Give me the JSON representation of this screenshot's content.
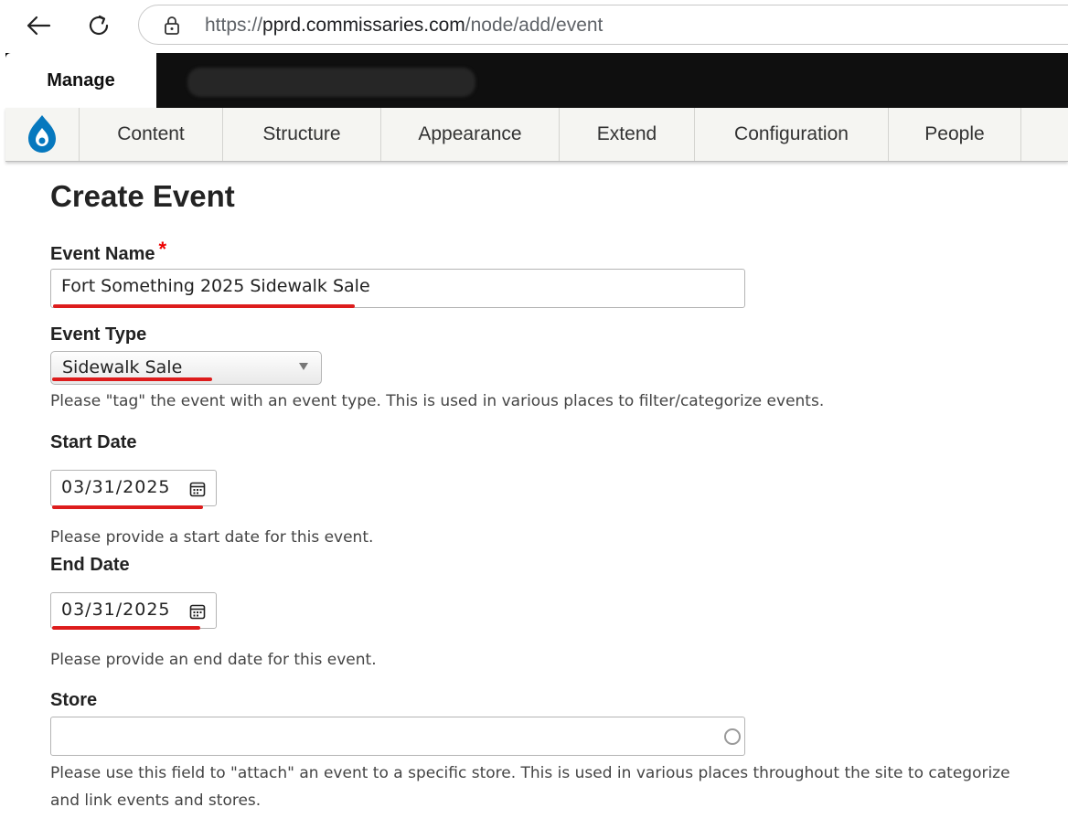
{
  "browser": {
    "url_scheme": "https://",
    "url_domain": "pprd.commissaries.com",
    "url_path": "/node/add/event"
  },
  "toolbar": {
    "manage_label": "Manage"
  },
  "menu": {
    "items": [
      {
        "label": "Content"
      },
      {
        "label": "Structure"
      },
      {
        "label": "Appearance"
      },
      {
        "label": "Extend"
      },
      {
        "label": "Configuration"
      },
      {
        "label": "People"
      }
    ]
  },
  "form": {
    "title": "Create Event",
    "event_name": {
      "label": "Event Name",
      "required_mark": "*",
      "value": "Fort Something 2025 Sidewalk Sale"
    },
    "event_type": {
      "label": "Event Type",
      "value": "Sidewalk Sale",
      "description": "Please \"tag\" the event with an event type. This is used in various places to filter/categorize events."
    },
    "start_date": {
      "label": "Start Date",
      "value": "03/31/2025",
      "description": "Please provide a start date for this event."
    },
    "end_date": {
      "label": "End Date",
      "value": "03/31/2025",
      "description": "Please provide an end date for this event."
    },
    "store": {
      "label": "Store",
      "value": "",
      "description_line1": "Please use this field to \"attach\" an event to a specific store. This is used in various places throughout the site to categorize",
      "description_line2": "and link events and stores."
    }
  },
  "colors": {
    "annotation_underline": "#dd1c1c",
    "required": "#ee0000",
    "drupal_blue": "#0678be"
  },
  "icons": [
    "back-arrow-icon",
    "reload-icon",
    "lock-icon",
    "drupal-logo-icon",
    "chevron-down-icon",
    "calendar-icon",
    "autocomplete-throbber-icon"
  ]
}
